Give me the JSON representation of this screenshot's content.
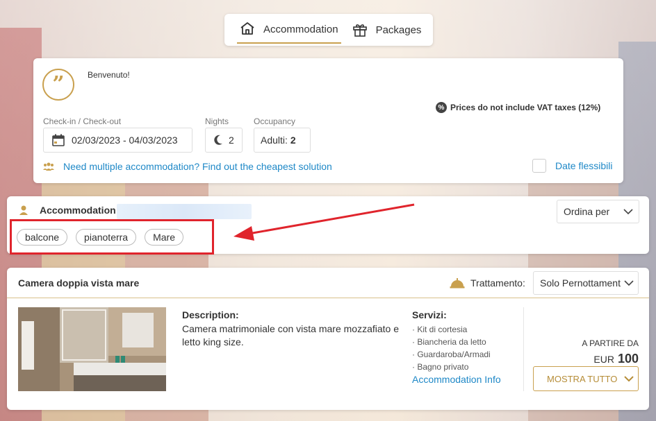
{
  "tabs": [
    {
      "label": "Accommodation",
      "icon": "house-icon",
      "active": true
    },
    {
      "label": "Packages",
      "icon": "gift-icon",
      "active": false
    }
  ],
  "search": {
    "welcome": "Benvenuto!",
    "vat_note": "Prices do not include VAT taxes (12%)",
    "dates_label": "Check-in / Check-out",
    "dates_value": "02/03/2023 - 04/03/2023",
    "nights_label": "Nights",
    "nights_value": "2",
    "occupancy_label": "Occupancy",
    "occupancy_prefix": "Adulti:",
    "occupancy_value": "2",
    "multi_link": "Need multiple accommodation? Find out the cheapest solution",
    "flex_dates": "Date flessibili"
  },
  "filter": {
    "title": "Accommodation",
    "sort_label": "Ordina per",
    "chips": [
      "balcone",
      "pianoterra",
      "Mare"
    ]
  },
  "room": {
    "title": "Camera doppia vista mare",
    "treatment_label": "Trattamento:",
    "treatment_value": "Solo Pernottament",
    "description_heading": "Description:",
    "description_text": "Camera matrimoniale con vista mare mozzafiato e letto king size.",
    "services_heading": "Servizi:",
    "services": [
      "· Kit di cortesia",
      "· Biancheria da letto",
      "· Guardaroba/Armadi",
      "· Bagno privato"
    ],
    "info_link": "Accommodation Info",
    "from_label": "A PARTIRE DA",
    "currency": "EUR",
    "price": "100",
    "show_all": "MOSTRA TUTTO"
  },
  "colors": {
    "accent_gold": "#c9a04e",
    "link_blue": "#1e88c7",
    "highlight_red": "#e0242c"
  }
}
